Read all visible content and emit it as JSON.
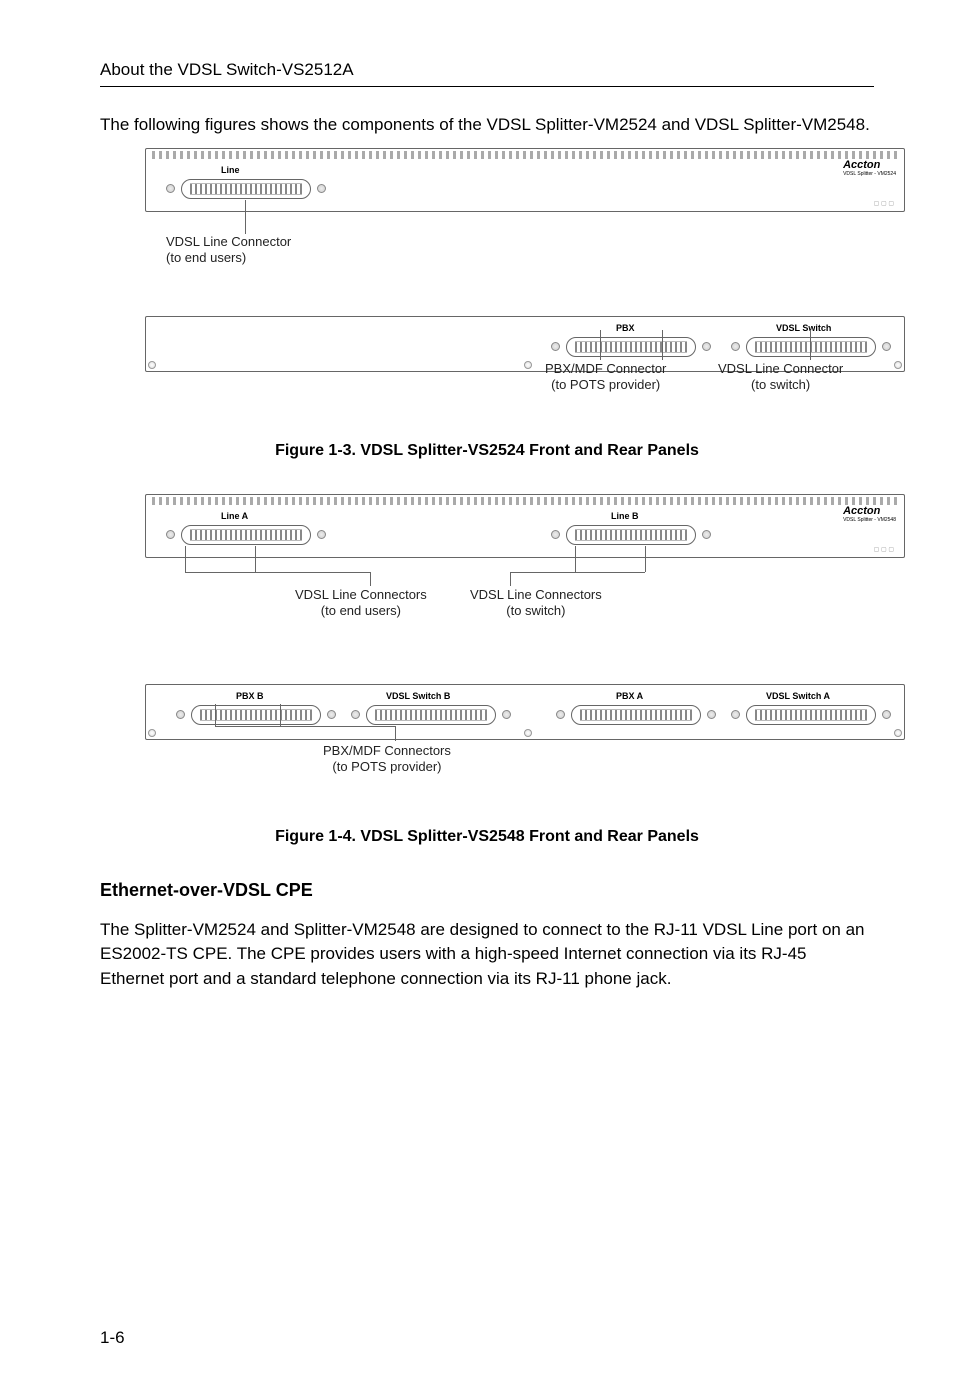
{
  "header": {
    "title": "About the VDSL Switch-VS2512A"
  },
  "intro_text": "The following figures shows the components of the VDSL Splitter-VM2524 and VDSL Splitter-VM2548.",
  "fig13": {
    "caption": "Figure 1-3.  VDSL Splitter-VS2524 Front and Rear Panels",
    "front": {
      "line_label": "Line",
      "brand": "Accton",
      "brand_sub": "VDSL Splitter - VM2524",
      "callout1": "VDSL Line Connector\n(to end users)"
    },
    "rear": {
      "pbx_label": "PBX",
      "switch_label": "VDSL Switch",
      "callout_pbx": "PBX/MDF Connector\n(to POTS provider)",
      "callout_switch": "VDSL Line Connector\n(to switch)"
    }
  },
  "fig14": {
    "caption": "Figure 1-4.  VDSL Splitter-VS2548 Front and Rear Panels",
    "front": {
      "lineA": "Line A",
      "lineB": "Line B",
      "brand": "Accton",
      "brand_sub": "VDSL Splitter - VM2548",
      "callout_end": "VDSL Line Connectors\n(to end users)",
      "callout_switch": "VDSL Line Connectors\n(to switch)"
    },
    "rear": {
      "pbxB": "PBX B",
      "switchB": "VDSL Switch B",
      "pbxA": "PBX A",
      "switchA": "VDSL Switch A",
      "callout_pbx": "PBX/MDF Connectors\n(to POTS provider)"
    }
  },
  "section_cpe": {
    "heading": "Ethernet-over-VDSL CPE",
    "body": "The Splitter-VM2524 and Splitter-VM2548 are designed to connect to the RJ-11 VDSL Line port on an ES2002-TS CPE. The CPE provides users with a high-speed Internet connection via its RJ-45 Ethernet port and a standard telephone connection via its RJ-11 phone jack."
  },
  "page_number": "1-6"
}
